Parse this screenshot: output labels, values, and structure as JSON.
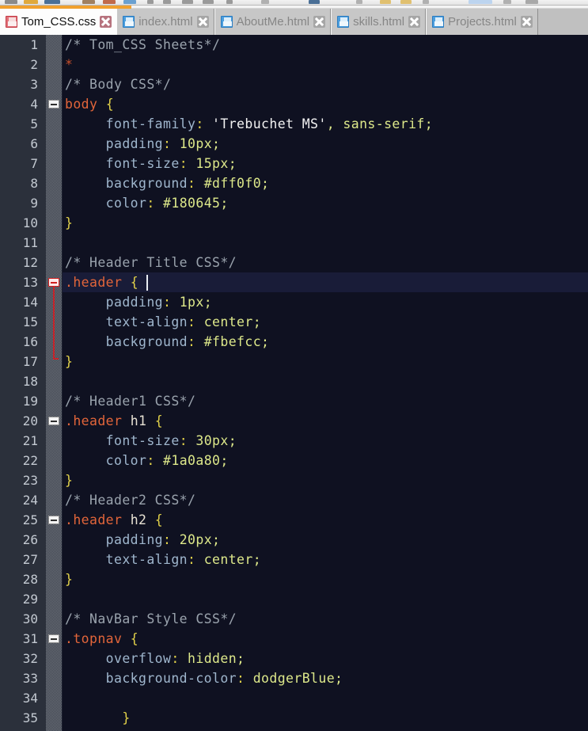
{
  "window": {
    "app": "code-editor",
    "toolbar_visible_strip": true
  },
  "tabs": [
    {
      "label": "Tom_CSS.css",
      "icon": "save-disk-icon",
      "icon_color": "#e2727a",
      "active": true,
      "close_icon": "close-icon",
      "close_color": "#b7737e"
    },
    {
      "label": "index.html",
      "icon": "save-disk-icon",
      "icon_color": "#4b9ede",
      "active": false,
      "close_icon": "close-icon",
      "close_color": "#a6a6a6"
    },
    {
      "label": "AboutMe.html",
      "icon": "save-disk-icon",
      "icon_color": "#4b9ede",
      "active": false,
      "close_icon": "close-icon",
      "close_color": "#a6a6a6"
    },
    {
      "label": "skills.html",
      "icon": "save-disk-icon",
      "icon_color": "#4b9ede",
      "active": false,
      "close_icon": "close-icon",
      "close_color": "#a6a6a6"
    },
    {
      "label": "Projects.html",
      "icon": "save-disk-icon",
      "icon_color": "#4b9ede",
      "active": false,
      "close_icon": "close-icon",
      "close_color": "#a6a6a6"
    }
  ],
  "editor": {
    "background": "#0f1121",
    "current_line_background": "#191c38",
    "gutter_background": "#2b303b",
    "line_number_color": "#c3c9d1",
    "current_line": 13,
    "first_visible_line": 1,
    "last_visible_line": 35,
    "language": "CSS",
    "caret_line": 13,
    "caret_column": 10,
    "lines": [
      {
        "n": 1,
        "fold": null,
        "tokens": [
          {
            "t": "/* Tom_CSS Sheets*/",
            "c": "comment"
          }
        ]
      },
      {
        "n": 2,
        "fold": null,
        "tokens": [
          {
            "t": "*",
            "c": "star"
          }
        ]
      },
      {
        "n": 3,
        "fold": null,
        "tokens": [
          {
            "t": "/* Body CSS*/",
            "c": "comment"
          }
        ]
      },
      {
        "n": 4,
        "fold": "open",
        "tokens": [
          {
            "t": "body",
            "c": "sel"
          },
          {
            "t": " ",
            "c": "plain"
          },
          {
            "t": "{",
            "c": "brace"
          }
        ]
      },
      {
        "n": 5,
        "fold": null,
        "tokens": [
          {
            "t": "     font-family",
            "c": "prop"
          },
          {
            "t": ":",
            "c": "colon"
          },
          {
            "t": " ",
            "c": "plain"
          },
          {
            "t": "'Trebuchet MS'",
            "c": "str"
          },
          {
            "t": ",",
            "c": "punct"
          },
          {
            "t": " sans-serif;",
            "c": "val"
          }
        ]
      },
      {
        "n": 6,
        "fold": null,
        "tokens": [
          {
            "t": "     padding",
            "c": "prop"
          },
          {
            "t": ":",
            "c": "colon"
          },
          {
            "t": " 10px;",
            "c": "val"
          }
        ]
      },
      {
        "n": 7,
        "fold": null,
        "tokens": [
          {
            "t": "     font-size",
            "c": "prop"
          },
          {
            "t": ":",
            "c": "colon"
          },
          {
            "t": " 15px;",
            "c": "val"
          }
        ]
      },
      {
        "n": 8,
        "fold": null,
        "tokens": [
          {
            "t": "     background",
            "c": "prop"
          },
          {
            "t": ":",
            "c": "colon"
          },
          {
            "t": " #dff0f0;",
            "c": "val"
          }
        ]
      },
      {
        "n": 9,
        "fold": null,
        "tokens": [
          {
            "t": "     color",
            "c": "prop"
          },
          {
            "t": ":",
            "c": "colon"
          },
          {
            "t": " #180645;",
            "c": "val"
          }
        ]
      },
      {
        "n": 10,
        "fold": null,
        "tokens": [
          {
            "t": "}",
            "c": "brace"
          }
        ]
      },
      {
        "n": 11,
        "fold": null,
        "tokens": []
      },
      {
        "n": 12,
        "fold": null,
        "tokens": [
          {
            "t": "/* Header Title CSS*/",
            "c": "comment"
          }
        ]
      },
      {
        "n": 13,
        "fold": "open-red",
        "tokens": [
          {
            "t": ".header",
            "c": "sel"
          },
          {
            "t": " ",
            "c": "plain"
          },
          {
            "t": "{",
            "c": "brace"
          }
        ]
      },
      {
        "n": 14,
        "fold": null,
        "tokens": [
          {
            "t": "     padding",
            "c": "prop"
          },
          {
            "t": ":",
            "c": "colon"
          },
          {
            "t": " 1px;",
            "c": "val"
          }
        ]
      },
      {
        "n": 15,
        "fold": null,
        "tokens": [
          {
            "t": "     text-align",
            "c": "prop"
          },
          {
            "t": ":",
            "c": "colon"
          },
          {
            "t": " center;",
            "c": "val"
          }
        ]
      },
      {
        "n": 16,
        "fold": null,
        "tokens": [
          {
            "t": "     background",
            "c": "prop"
          },
          {
            "t": ":",
            "c": "colon"
          },
          {
            "t": " #fbefcc;",
            "c": "val"
          }
        ]
      },
      {
        "n": 17,
        "fold": "end-red",
        "tokens": [
          {
            "t": "}",
            "c": "brace"
          }
        ]
      },
      {
        "n": 18,
        "fold": null,
        "tokens": []
      },
      {
        "n": 19,
        "fold": null,
        "tokens": [
          {
            "t": "/* Header1 CSS*/",
            "c": "comment"
          }
        ]
      },
      {
        "n": 20,
        "fold": "open",
        "tokens": [
          {
            "t": ".header",
            "c": "sel"
          },
          {
            "t": " ",
            "c": "plain"
          },
          {
            "t": "h1",
            "c": "sel2"
          },
          {
            "t": " ",
            "c": "plain"
          },
          {
            "t": "{",
            "c": "brace"
          }
        ]
      },
      {
        "n": 21,
        "fold": null,
        "tokens": [
          {
            "t": "     font-size",
            "c": "prop"
          },
          {
            "t": ":",
            "c": "colon"
          },
          {
            "t": " 30px;",
            "c": "val"
          }
        ]
      },
      {
        "n": 22,
        "fold": null,
        "tokens": [
          {
            "t": "     color",
            "c": "prop"
          },
          {
            "t": ":",
            "c": "colon"
          },
          {
            "t": " #1a0a80;",
            "c": "val"
          }
        ]
      },
      {
        "n": 23,
        "fold": null,
        "tokens": [
          {
            "t": "}",
            "c": "brace"
          }
        ]
      },
      {
        "n": 24,
        "fold": null,
        "tokens": [
          {
            "t": "/* Header2 CSS*/",
            "c": "comment"
          }
        ]
      },
      {
        "n": 25,
        "fold": "open",
        "tokens": [
          {
            "t": ".header",
            "c": "sel"
          },
          {
            "t": " ",
            "c": "plain"
          },
          {
            "t": "h2",
            "c": "sel2"
          },
          {
            "t": " ",
            "c": "plain"
          },
          {
            "t": "{",
            "c": "brace"
          }
        ]
      },
      {
        "n": 26,
        "fold": null,
        "tokens": [
          {
            "t": "     padding",
            "c": "prop"
          },
          {
            "t": ":",
            "c": "colon"
          },
          {
            "t": " 20px;",
            "c": "val"
          }
        ]
      },
      {
        "n": 27,
        "fold": null,
        "tokens": [
          {
            "t": "     text-align",
            "c": "prop"
          },
          {
            "t": ":",
            "c": "colon"
          },
          {
            "t": " center;",
            "c": "val"
          }
        ]
      },
      {
        "n": 28,
        "fold": null,
        "tokens": [
          {
            "t": "}",
            "c": "brace"
          }
        ]
      },
      {
        "n": 29,
        "fold": null,
        "tokens": []
      },
      {
        "n": 30,
        "fold": null,
        "tokens": [
          {
            "t": "/* NavBar Style CSS*/",
            "c": "comment"
          }
        ]
      },
      {
        "n": 31,
        "fold": "open",
        "tokens": [
          {
            "t": ".topnav",
            "c": "sel"
          },
          {
            "t": " ",
            "c": "plain"
          },
          {
            "t": "{",
            "c": "brace"
          }
        ]
      },
      {
        "n": 32,
        "fold": null,
        "tokens": [
          {
            "t": "     overflow",
            "c": "prop"
          },
          {
            "t": ":",
            "c": "colon"
          },
          {
            "t": " hidden;",
            "c": "val"
          }
        ]
      },
      {
        "n": 33,
        "fold": null,
        "tokens": [
          {
            "t": "     background-color",
            "c": "prop"
          },
          {
            "t": ":",
            "c": "colon"
          },
          {
            "t": " dodgerBlue;",
            "c": "val"
          }
        ]
      },
      {
        "n": 34,
        "fold": null,
        "tokens": []
      },
      {
        "n": 35,
        "fold": null,
        "tokens": [
          {
            "t": "       }",
            "c": "brace"
          }
        ]
      }
    ]
  },
  "colors": {
    "tab_active_indicator": "#f0a02e",
    "comment": "#9aa3ad",
    "selector": "#e2653a",
    "brace": "#e2d24a",
    "property": "#9fb6cd",
    "value": "#dde88a",
    "string": "#f2f2f2",
    "fold_marker_active": "#c6242a"
  }
}
